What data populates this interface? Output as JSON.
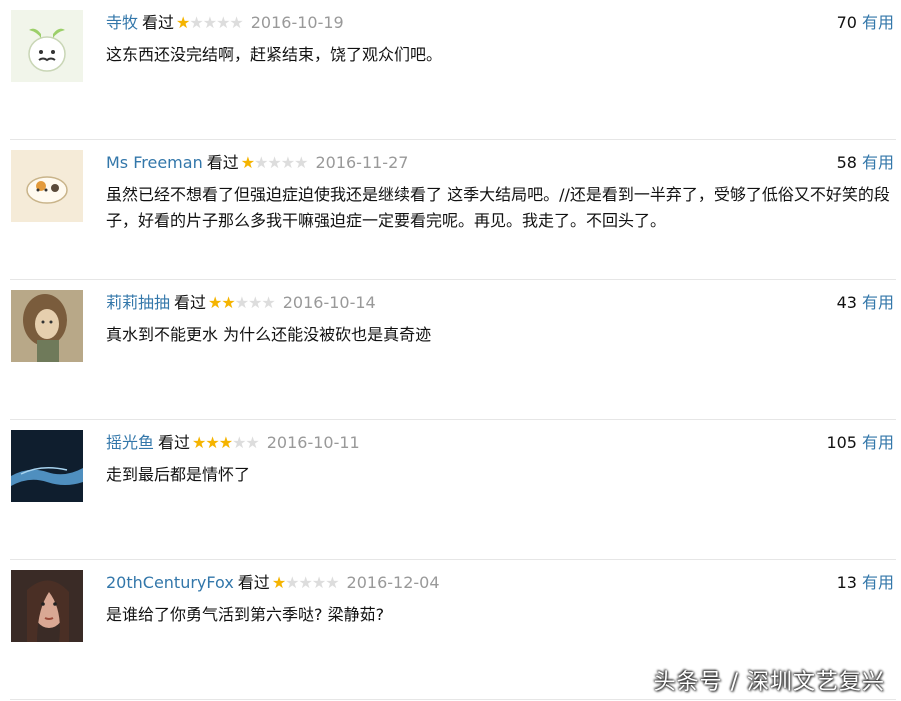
{
  "reviews": [
    {
      "user": "寺牧",
      "status": "看过",
      "rating": 1,
      "date": "2016-10-19",
      "votes": "70",
      "useful_label": "有用",
      "content": "这东西还没完结啊，赶紧结束，饶了观众们吧。"
    },
    {
      "user": "Ms Freeman",
      "status": "看过",
      "rating": 1,
      "date": "2016-11-27",
      "votes": "58",
      "useful_label": "有用",
      "content": "虽然已经不想看了但强迫症迫使我还是继续看了 这季大结局吧。//还是看到一半弃了，受够了低俗又不好笑的段子，好看的片子那么多我干嘛强迫症一定要看完呢。再见。我走了。不回头了。"
    },
    {
      "user": "莉莉抽抽",
      "status": "看过",
      "rating": 2,
      "date": "2016-10-14",
      "votes": "43",
      "useful_label": "有用",
      "content": "真水到不能更水 为什么还能没被砍也是真奇迹"
    },
    {
      "user": "摇光鱼",
      "status": "看过",
      "rating": 3,
      "date": "2016-10-11",
      "votes": "105",
      "useful_label": "有用",
      "content": "走到最后都是情怀了"
    },
    {
      "user": "20thCenturyFox",
      "status": "看过",
      "rating": 1,
      "date": "2016-12-04",
      "votes": "13",
      "useful_label": "有用",
      "content": "是谁给了你勇气活到第六季哒? 梁静茹?"
    }
  ],
  "watermark": "头条号 / 深圳文艺复兴",
  "colors": {
    "link": "#3377aa",
    "star_on": "#f5b400",
    "star_off": "#dddddd",
    "date": "#999999"
  }
}
